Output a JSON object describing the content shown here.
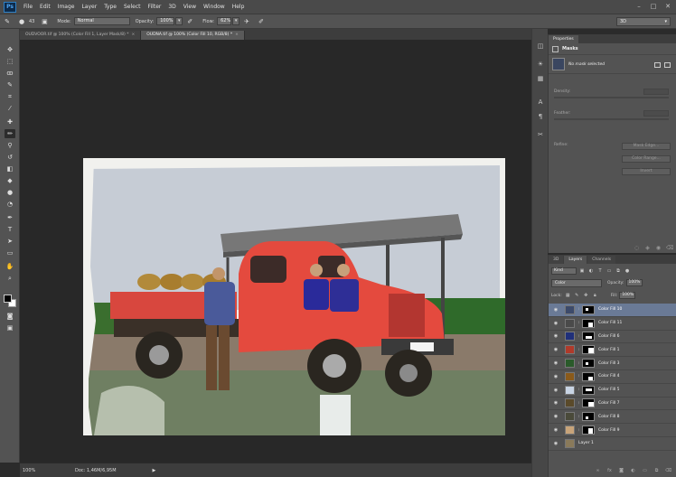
{
  "menu": {
    "logo": "Ps",
    "items": [
      "File",
      "Edit",
      "Image",
      "Layer",
      "Type",
      "Select",
      "Filter",
      "3D",
      "View",
      "Window",
      "Help"
    ]
  },
  "options": {
    "brush_size": "43",
    "mode_label": "Mode:",
    "mode_value": "Normal",
    "opacity_label": "Opacity:",
    "opacity_value": "100%",
    "flow_label": "Flow:",
    "flow_value": "62%",
    "workspace": "3D"
  },
  "tabs": [
    {
      "label": "OUDVOOR.tif @ 100% (Color Fill 1, Layer Mask/8) *",
      "active": false
    },
    {
      "label": "OUDNA.tif @ 100% (Color Fill 10, RGB/8) *",
      "active": true
    }
  ],
  "status": {
    "zoom": "100%",
    "doc": "Doc: 1,46M/6,95M"
  },
  "properties": {
    "tab": "Properties",
    "section": "Masks",
    "mask_text": "No mask selected",
    "density_label": "Density:",
    "feather_label": "Feather:",
    "refine_label": "Refine:",
    "mask_edge_btn": "Mask Edge...",
    "color_range_btn": "Color Range...",
    "invert_btn": "Invert"
  },
  "layers_panel": {
    "tabs": [
      "3D",
      "Layers",
      "Channels"
    ],
    "active_tab": "Layers",
    "kind": "Kind",
    "blend_mode": "Color",
    "opacity_label": "Opacity:",
    "opacity_value": "100%",
    "lock_label": "Lock:",
    "fill_label": "Fill:",
    "fill_value": "100%",
    "layers": [
      {
        "name": "Color Fill 10",
        "color": "#3c4a6a",
        "selected": true
      },
      {
        "name": "Color Fill 11",
        "color": "#4a4a4a",
        "selected": false
      },
      {
        "name": "Color Fill 6",
        "color": "#20307a",
        "selected": false
      },
      {
        "name": "Color Fill 1",
        "color": "#b03a2a",
        "selected": false
      },
      {
        "name": "Color Fill 3",
        "color": "#2a5a2a",
        "selected": false
      },
      {
        "name": "Color Fill 4",
        "color": "#8a5a1a",
        "selected": false
      },
      {
        "name": "Color Fill 5",
        "color": "#c8d4e4",
        "selected": false
      },
      {
        "name": "Color Fill 7",
        "color": "#5a4a2a",
        "selected": false
      },
      {
        "name": "Color Fill 8",
        "color": "#4a4a3a",
        "selected": false
      },
      {
        "name": "Color Fill 9",
        "color": "#c8a47a",
        "selected": false
      },
      {
        "name": "Layer 1",
        "color": "#8a7a5a",
        "selected": false
      }
    ]
  }
}
